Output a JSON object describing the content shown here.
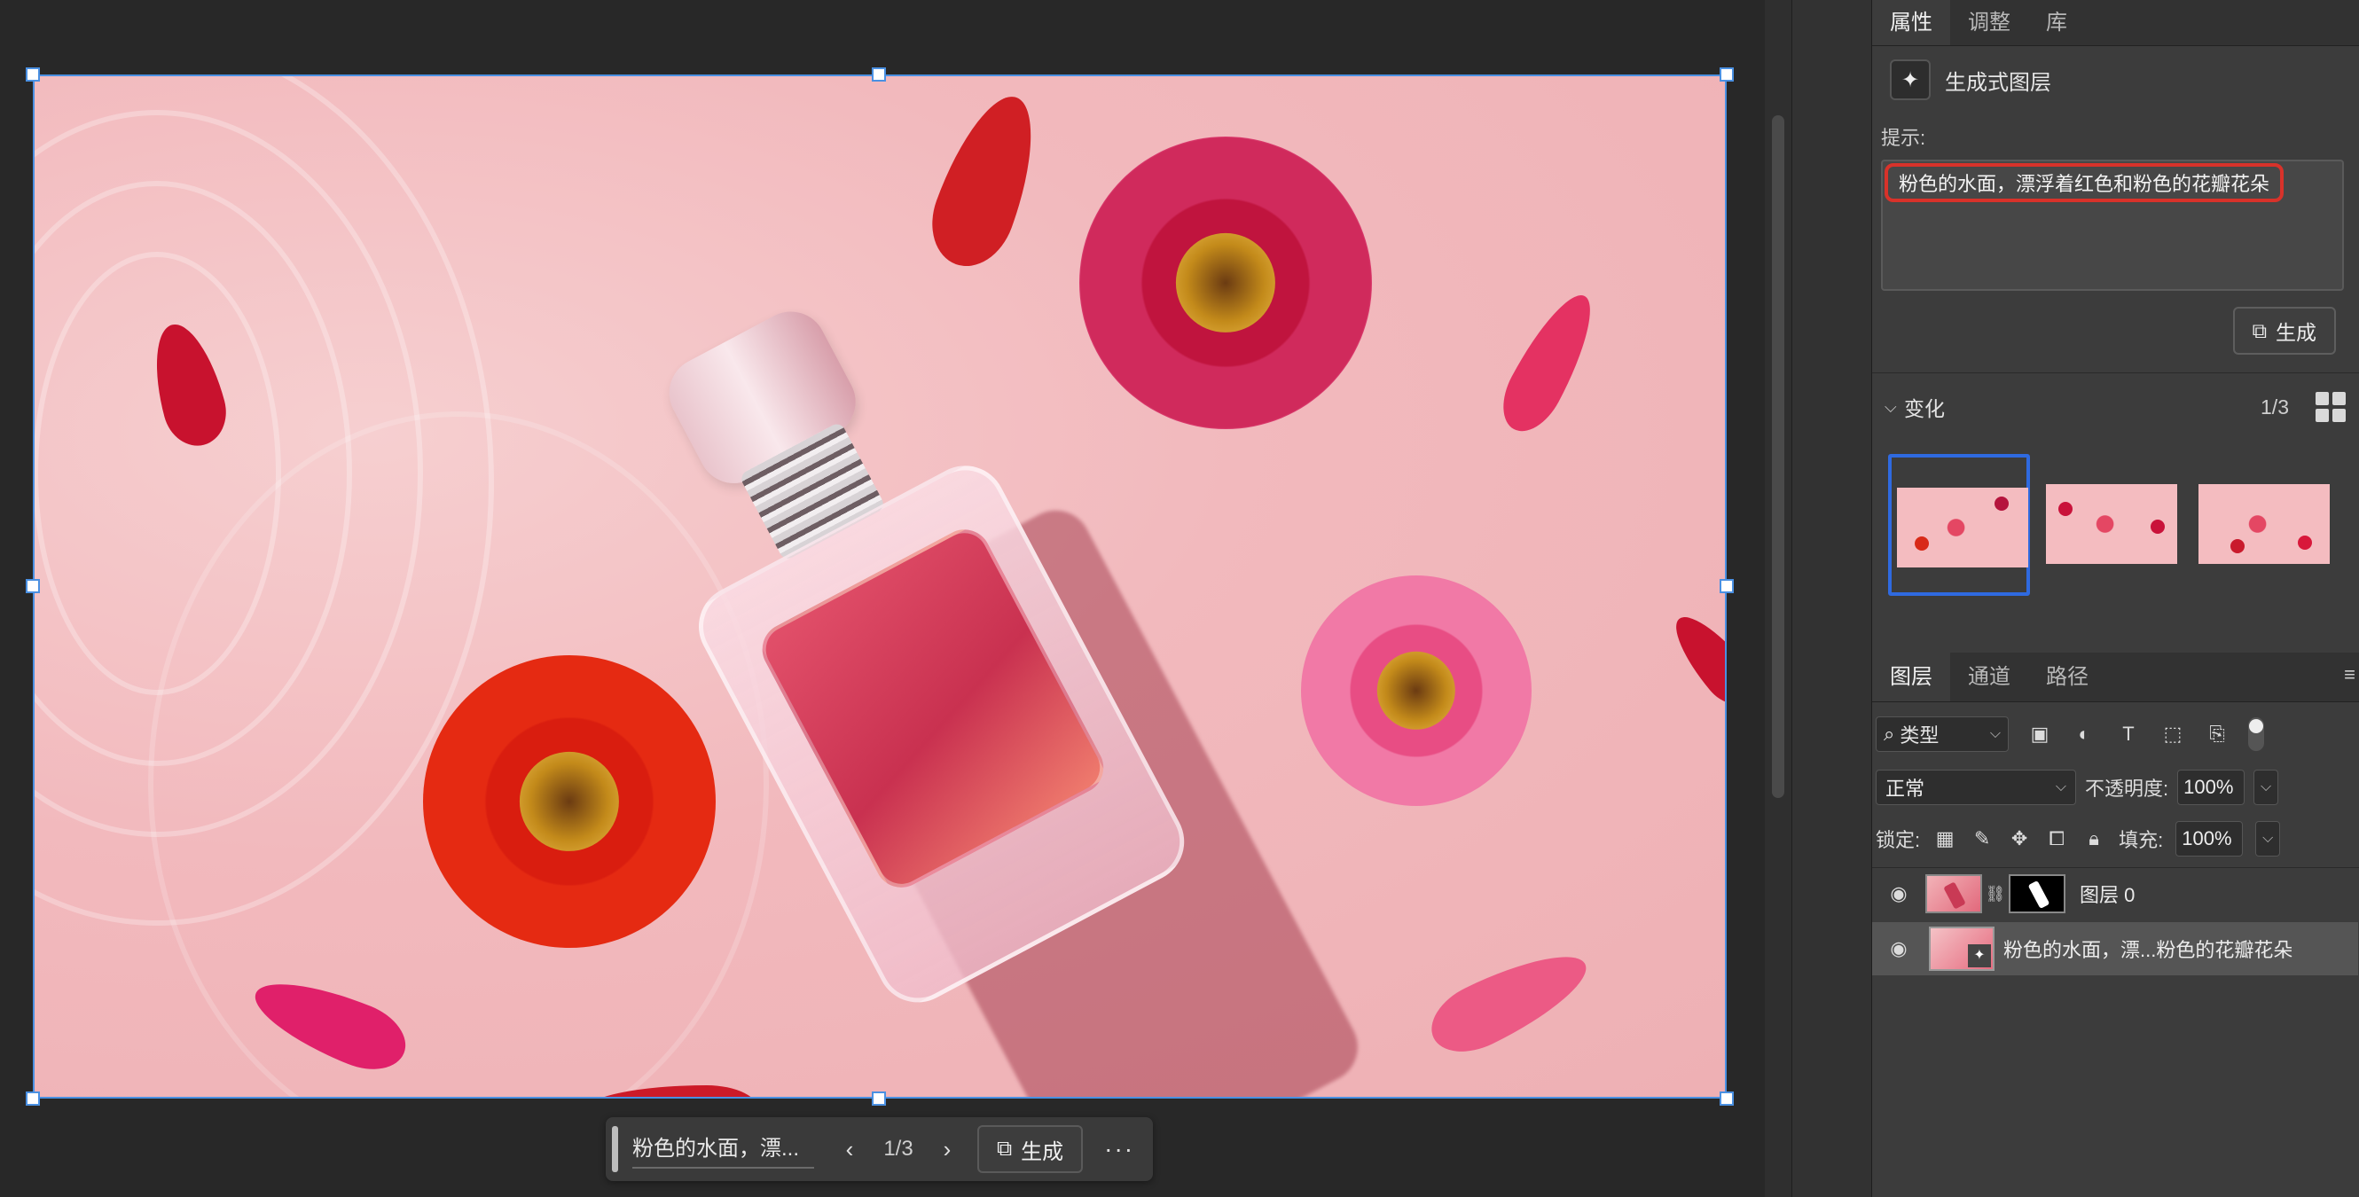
{
  "taskbar": {
    "prompt_truncated": "粉色的水面，漂...",
    "prev_icon": "chevron-left-icon",
    "next_icon": "chevron-right-icon",
    "variation_counter": "1/3",
    "generate_label": "生成",
    "more_icon": "ellipsis-icon",
    "more_label": "···"
  },
  "panel_tabs": [
    "属性",
    "调整",
    "库"
  ],
  "properties": {
    "layer_kind": "生成式图层",
    "prompt_label": "提示:",
    "prompt_value": "粉色的水面，漂浮着红色和粉色的花瓣花朵",
    "generate_label": "生成",
    "highlight_color": "#d8322a"
  },
  "variations": {
    "header": "变化",
    "counter": "1/3",
    "selected_index": 0,
    "thumbnails": [
      "variation-1",
      "variation-2",
      "variation-3"
    ],
    "selection_color": "#2f6ae0"
  },
  "layers_panel": {
    "tabs": [
      "图层",
      "通道",
      "路径"
    ],
    "filter_label": "类型",
    "blend_mode": "正常",
    "opacity_label": "不透明度:",
    "opacity_value": "100%",
    "lock_label": "锁定:",
    "fill_label": "填充:",
    "fill_value": "100%",
    "layers": [
      {
        "name": "图层 0",
        "visible": true,
        "has_mask": true,
        "selected": false
      },
      {
        "name": "粉色的水面，漂...粉色的花瓣花朵",
        "visible": true,
        "generative": true,
        "selected": true
      }
    ]
  },
  "colors": {
    "canvas_bg": "#282828",
    "panel_bg": "#3c3c3c",
    "selection_border": "#4a90e2"
  }
}
